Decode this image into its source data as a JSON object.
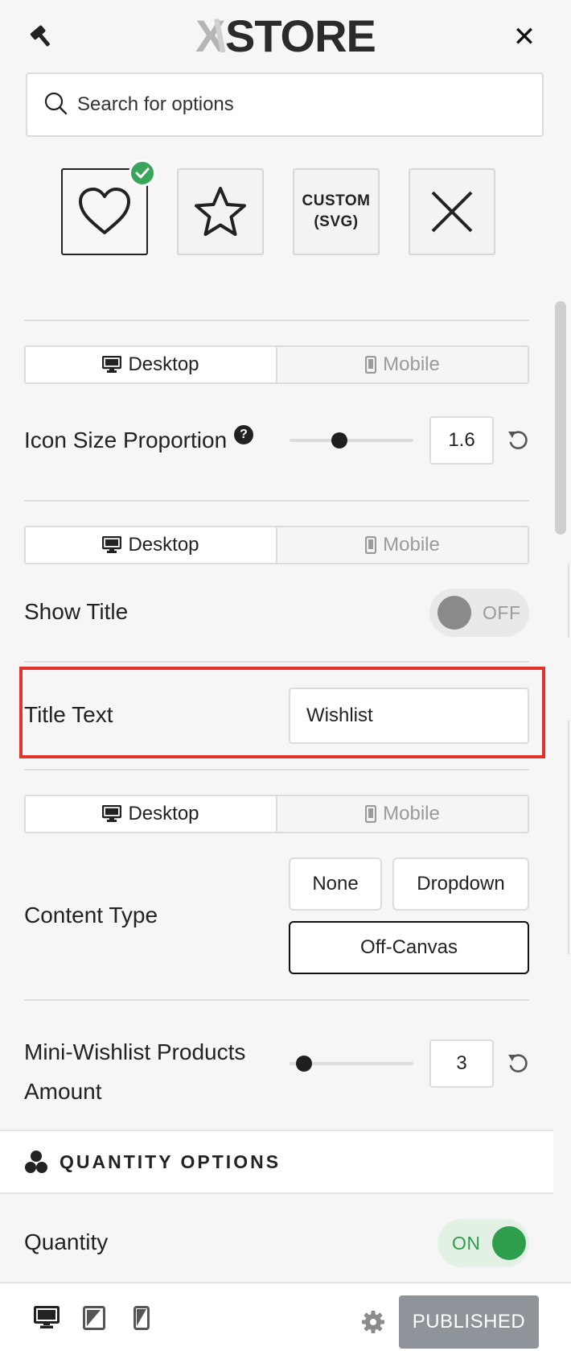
{
  "header": {
    "logo_x": "X",
    "logo_rest": "STORE",
    "close_label": "✕"
  },
  "search": {
    "placeholder": "Search for options",
    "value": ""
  },
  "icon_choices": {
    "selected": "heart",
    "items": [
      {
        "name": "heart-icon"
      },
      {
        "name": "star-icon"
      },
      {
        "label_line1": "CUSTOM",
        "label_line2": "(SVG)"
      },
      {
        "name": "none-x-icon"
      }
    ]
  },
  "device_switch": {
    "desktop": "Desktop",
    "mobile": "Mobile"
  },
  "icon_size": {
    "label": "Icon Size Proportion",
    "help": "?",
    "value": "1.6",
    "fraction": 0.4
  },
  "show_title": {
    "label": "Show Title",
    "state": "OFF"
  },
  "title_text": {
    "label": "Title Text",
    "value": "Wishlist"
  },
  "content_type": {
    "label": "Content Type",
    "options": [
      "None",
      "Dropdown",
      "Off-Canvas"
    ],
    "selected": "Off-Canvas"
  },
  "mini_wishlist": {
    "label_line1": "Mini-Wishlist Products",
    "label_line2": "Amount",
    "value": "3",
    "fraction": 0.12
  },
  "section": {
    "title": "QUANTITY OPTIONS"
  },
  "quantity": {
    "label": "Quantity",
    "state": "ON"
  },
  "footer": {
    "publish_label": "PUBLISHED"
  },
  "colors": {
    "accent_green": "#2e9e4c",
    "highlight_red": "#e0342a",
    "publish_gray": "#8f939a"
  }
}
